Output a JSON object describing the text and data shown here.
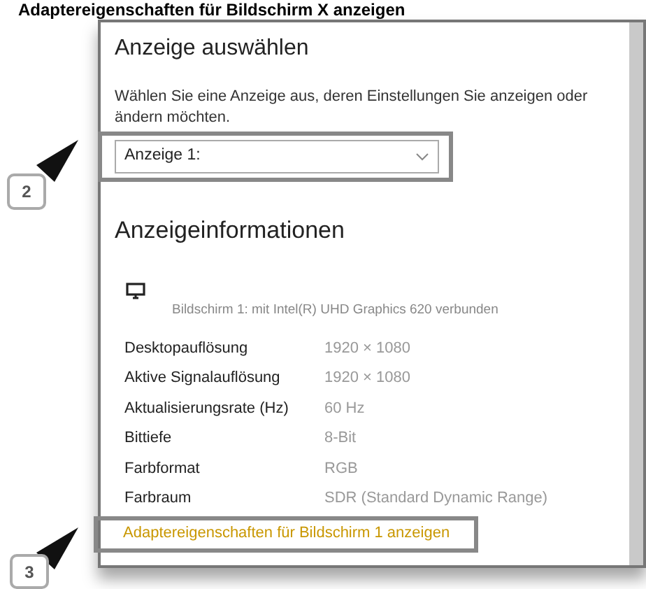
{
  "caption": "Adaptereigenschaften für Bildschirm X anzeigen",
  "select_display": {
    "title": "Anzeige auswählen",
    "description": "Wählen Sie eine Anzeige aus, deren Einstellungen Sie anzeigen oder ändern möchten.",
    "dropdown": {
      "value": "Anzeige 1:"
    },
    "callout": "2"
  },
  "display_info": {
    "title": "Anzeigeinformationen",
    "monitor_text": "Bildschirm 1: mit Intel(R) UHD Graphics 620 verbunden",
    "rows": [
      {
        "label": "Desktopauflösung",
        "value": "1920 × 1080"
      },
      {
        "label": "Aktive Signalauflösung",
        "value": "1920 × 1080"
      },
      {
        "label": "Aktualisierungsrate (Hz)",
        "value": "60 Hz"
      },
      {
        "label": "Bittiefe",
        "value": "8-Bit"
      },
      {
        "label": "Farbformat",
        "value": "RGB"
      },
      {
        "label": "Farbraum",
        "value": "SDR (Standard Dynamic Range)"
      }
    ],
    "link": "Adaptereigenschaften für Bildschirm 1 anzeigen",
    "callout": "3"
  }
}
